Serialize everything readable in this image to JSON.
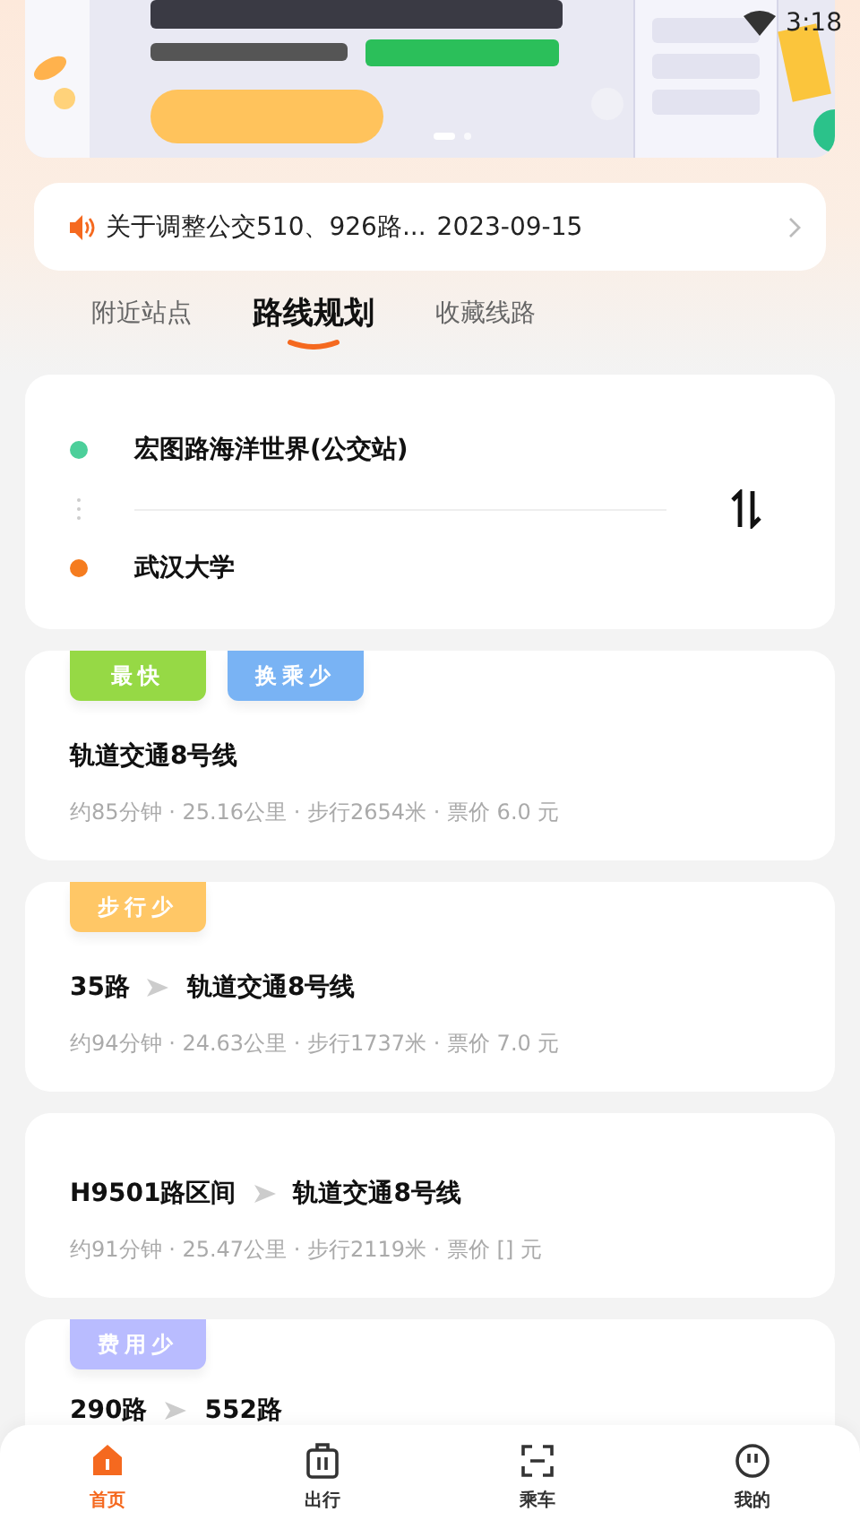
{
  "status_bar": {
    "time": "3:18"
  },
  "banner": {
    "kind": "picture",
    "pages": [
      {
        "selected": true
      },
      {
        "selected": false
      }
    ]
  },
  "notice": {
    "text": "关于调整公交510、926路...",
    "date": "2023-09-15"
  },
  "tabs": [
    {
      "label": "附近站点",
      "selected": false
    },
    {
      "label": "路线规划",
      "selected": true
    },
    {
      "label": "收藏线路",
      "selected": false
    }
  ],
  "planner": {
    "origin": "宏图路海洋世界(公交站)",
    "destination": "武汉大学"
  },
  "routes": [
    {
      "tags": [
        {
          "label": "最快",
          "color": "#96d945"
        },
        {
          "label": "换乘少",
          "color": "#79b3f4"
        }
      ],
      "lines": [
        "轨道交通8号线"
      ],
      "summary": "约85分钟 · 25.16公里 · 步行2654米 · 票价 6.0 元"
    },
    {
      "tags": [
        {
          "label": "步行少",
          "color": "#ffc766"
        }
      ],
      "lines": [
        "35路",
        "轨道交通8号线"
      ],
      "summary": "约94分钟 · 24.63公里 · 步行1737米 · 票价 7.0 元"
    },
    {
      "lines": [
        "H9501路区间",
        "轨道交通8号线"
      ],
      "summary": "约91分钟 · 25.47公里 · 步行2119米 · 票价 [] 元"
    },
    {
      "tags": [
        {
          "label": "费用少",
          "color": "#b9bcff"
        }
      ],
      "lines": [
        "290路",
        "552路"
      ]
    }
  ],
  "nav": [
    {
      "kind": "home",
      "label": "首页",
      "selected": true
    },
    {
      "kind": "luggage",
      "label": "出行",
      "selected": false
    },
    {
      "kind": "scan",
      "label": "乘车",
      "selected": false
    },
    {
      "kind": "face",
      "label": "我的",
      "selected": false
    }
  ]
}
